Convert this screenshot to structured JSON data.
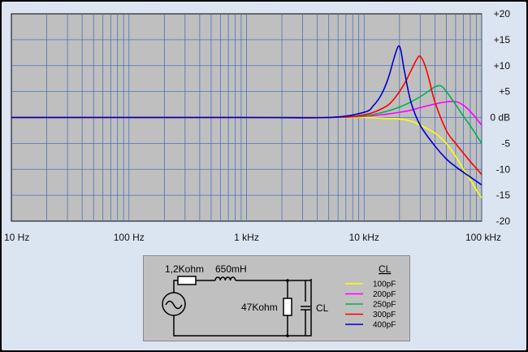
{
  "chart_data": {
    "type": "line",
    "x_scale": "log",
    "xlim": [
      10,
      100000
    ],
    "ylim": [
      -20,
      20
    ],
    "grid": true,
    "x_ticks": [
      "10 Hz",
      "100 Hz",
      "1 kHz",
      "10 kHz",
      "100 kHz"
    ],
    "y_ticks": [
      "+20",
      "+15",
      "+10",
      "+5",
      "0 dB",
      "-5",
      "-10",
      "-15",
      "-20"
    ],
    "legend_title": "CL",
    "series": [
      {
        "name": "100pF",
        "color": "#ffff00",
        "x": [
          10,
          1000,
          5000,
          10000,
          15000,
          20000,
          25000,
          30000,
          40000,
          50000,
          60000,
          70000,
          80000,
          90000,
          100000
        ],
        "y": [
          0,
          0,
          0,
          0,
          -0.2,
          -0.3,
          -0.7,
          -1.5,
          -3.0,
          -5.0,
          -7.5,
          -10,
          -12,
          -14,
          -15.5
        ]
      },
      {
        "name": "200pF",
        "color": "#ff00ff",
        "x": [
          10,
          1000,
          5000,
          10000,
          15000,
          20000,
          25000,
          30000,
          40000,
          50000,
          58000,
          65000,
          75000,
          85000,
          100000
        ],
        "y": [
          0,
          0,
          0,
          0.2,
          0.6,
          1.0,
          1.4,
          1.9,
          2.6,
          3.0,
          3.1,
          2.8,
          1.8,
          0.5,
          -1.5
        ]
      },
      {
        "name": "250pF",
        "color": "#00b050",
        "x": [
          10,
          1000,
          5000,
          10000,
          15000,
          20000,
          25000,
          30000,
          35000,
          40000,
          45000,
          50000,
          60000,
          70000,
          80000,
          100000
        ],
        "y": [
          0,
          0,
          0,
          0.3,
          1.1,
          2.0,
          3.0,
          4.0,
          5.0,
          5.9,
          6.1,
          5.0,
          2.5,
          0.2,
          -1.6,
          -5.0
        ]
      },
      {
        "name": "300pF",
        "color": "#ff0000",
        "x": [
          10,
          1000,
          5000,
          10000,
          15000,
          18000,
          22000,
          25000,
          28000,
          30000,
          33000,
          36000,
          40000,
          50000,
          60000,
          80000,
          100000
        ],
        "y": [
          0,
          0,
          0,
          0.5,
          2.0,
          3.6,
          6.5,
          9.0,
          11.2,
          11.8,
          10.0,
          7.0,
          3.0,
          -2.5,
          -5.0,
          -8.5,
          -11.0
        ]
      },
      {
        "name": "400pF",
        "color": "#0000cc",
        "x": [
          10,
          1000,
          5000,
          10000,
          12000,
          14000,
          16000,
          18000,
          19500,
          20500,
          22000,
          25000,
          30000,
          40000,
          50000,
          60000,
          80000,
          100000
        ],
        "y": [
          0,
          0,
          0,
          1.0,
          2.3,
          4.4,
          7.5,
          11.5,
          13.7,
          13.0,
          9.0,
          3.0,
          -1.5,
          -5.5,
          -8.0,
          -9.5,
          -11.5,
          -13.0
        ]
      }
    ]
  },
  "schematic": {
    "r1": "1,2Kohm",
    "l1": "650mH",
    "r2": "47Kohm",
    "c": "CL"
  }
}
